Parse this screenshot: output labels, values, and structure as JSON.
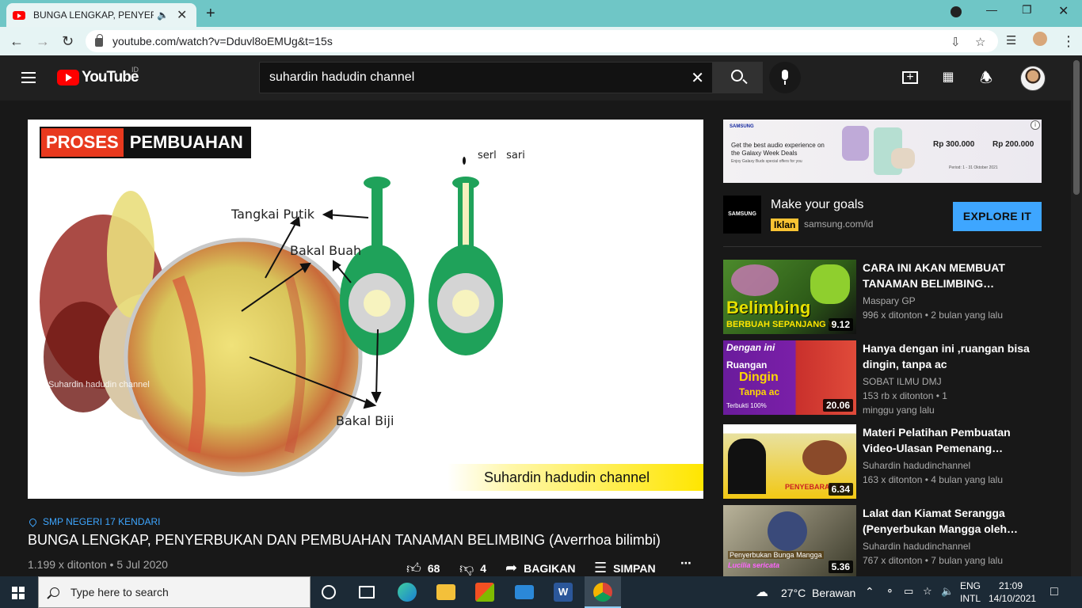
{
  "browser": {
    "tab_title": "BUNGA LENGKAP, PENYERBUKAN",
    "url": "youtube.com/watch?v=Dduvl8oEMUg&t=15s"
  },
  "youtube": {
    "logo_text": "YouTube",
    "country_code": "ID",
    "search_value": "suhardin hadudin channel"
  },
  "video_frame": {
    "badge_left": "PROSES",
    "badge_right": "PEMBUAHAN",
    "label_tangkai": "Tangkai Putik",
    "label_bakal_buah": "Bakal Buah",
    "label_bakal_biji": "Bakal Biji",
    "label_serbuk": "serl   sari",
    "watermark": "Suhardin hadudin channel",
    "banner": "Suhardin hadudin channel"
  },
  "video": {
    "location": "SMP NEGERI 17 KENDARI",
    "title": "BUNGA LENGKAP, PENYERBUKAN DAN PEMBUAHAN TANAMAN BELIMBING (Averrhoa bilimbi)",
    "meta": "1.199 x ditonton • 5 Jul 2020",
    "likes": "68",
    "dislikes": "4",
    "share": "BAGIKAN",
    "save": "SIMPAN"
  },
  "ad": {
    "brand": "SAMSUNG",
    "tagline": "Get the best audio experience on the Galaxy Week Deals",
    "sub": "Enjoy Galaxy Buds special offers for you",
    "price1": "Rp 300.000",
    "price2": "Rp 200.000",
    "period": "Period: 1 - 31 Oktober 2021",
    "headline": "Make your goals",
    "tag": "Iklan",
    "domain": "samsung.com/id",
    "cta": "EXPLORE IT",
    "logo": "SAMSUNG"
  },
  "recommendations": [
    {
      "title": "CARA INI AKAN MEMBUAT TANAMAN BELIMBING…",
      "channel": "Maspary GP",
      "meta": "996 x ditonton • 2 bulan yang lalu",
      "duration": "9.12",
      "thumb_text_1": "Belimbing",
      "thumb_text_2": "BERBUAH SEPANJANG W"
    },
    {
      "title": "Hanya dengan ini ,ruangan bisa dingin, tanpa ac",
      "channel": "SOBAT ILMU DMJ",
      "meta": "153 rb x ditonton • 1 minggu yang lalu",
      "duration": "20.06",
      "thumb_text_1": "Dengan ini",
      "thumb_text_2": "Ruangan",
      "thumb_text_3": "Dingin",
      "thumb_text_4": "Tanpa ac",
      "thumb_text_5": "Terbukti 100%"
    },
    {
      "title": "Materi Pelatihan Pembuatan Video-Ulasan Pemenang…",
      "channel": "Suhardin hadudinchannel",
      "meta": "163 x ditonton • 4 bulan yang lalu",
      "duration": "6.34",
      "thumb_text_1": "PENYEBARAN TA"
    },
    {
      "title": "Lalat dan Kiamat Serangga (Penyerbukan Mangga oleh…",
      "channel": "Suhardin hadudinchannel",
      "meta": "767 x ditonton • 7 bulan yang lalu",
      "duration": "5.36",
      "thumb_text_1": "Penyerbukan Bunga Mangga",
      "thumb_text_2": "Lucilia sericata"
    }
  ],
  "taskbar": {
    "search_placeholder": "Type here to search",
    "weather": "27°C  Berawan",
    "lang1": "ENG",
    "lang2": "INTL",
    "time": "21:09",
    "date": "14/10/2021"
  }
}
